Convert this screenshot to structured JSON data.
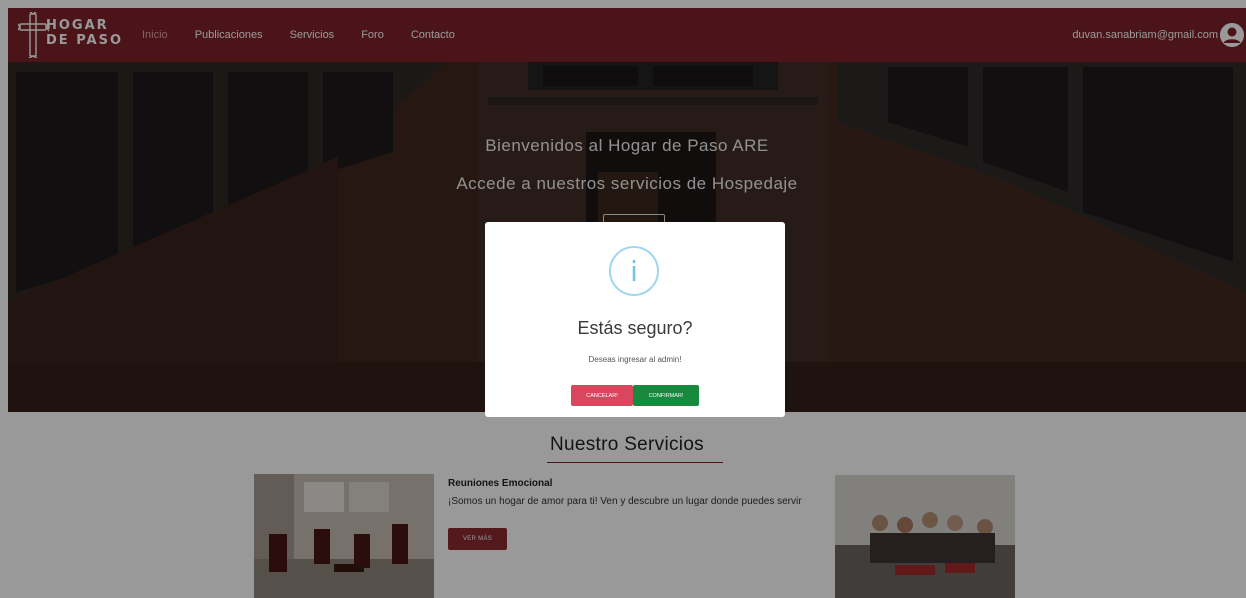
{
  "navbar": {
    "logo_line1": "HOGAR",
    "logo_line2": "DE PASO",
    "links": [
      "Inicio",
      "Publicaciones",
      "Servicios",
      "Foro",
      "Contacto"
    ],
    "active_link": "Inicio",
    "user_email": "duvan.sanabriam@gmail.com"
  },
  "hero": {
    "title": "Bienvenidos al Hogar de Paso ARE",
    "subtitle": "Accede a nuestros servicios de Hospedaje"
  },
  "services": {
    "title": "Nuestro Servicios",
    "item": {
      "heading": "Reuniones Emocional",
      "text": "¡Somos un hogar de amor para ti! Ven y descubre un lugar donde puedes servir",
      "button_label": "VER MÁS"
    }
  },
  "modal": {
    "icon": "info-icon",
    "icon_glyph": "i",
    "title": "Estás seguro?",
    "text": "Deseas ingresar al admin!",
    "cancel_label": "CANCELAR!",
    "confirm_label": "CONFIRMAR!"
  },
  "colors": {
    "brand": "#7d2229",
    "cancel": "#d9475f",
    "confirm": "#178a3e",
    "info": "#9fd7ee"
  }
}
